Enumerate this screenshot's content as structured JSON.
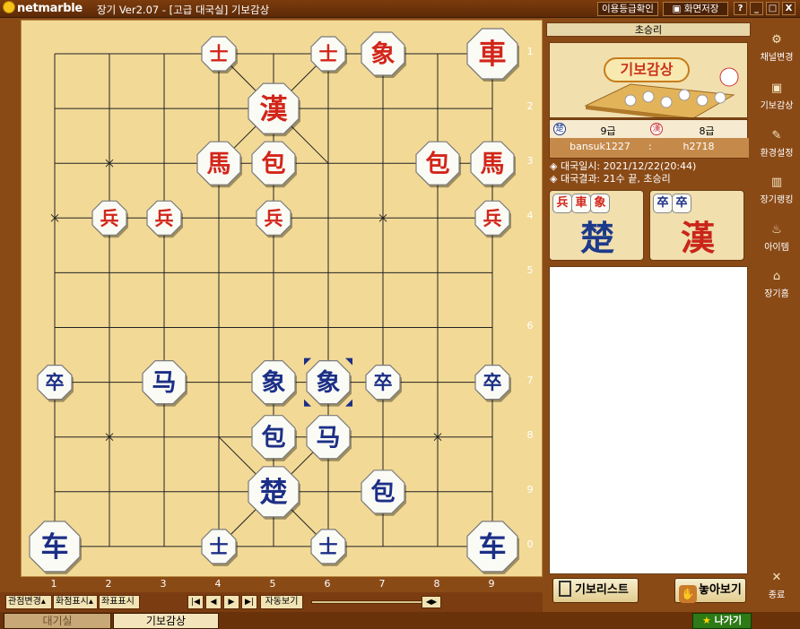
{
  "titlebar": {
    "logo": "netmarble",
    "title": "장기 Ver2.07 - [고급 대국실] 기보감상",
    "rating_button": "이용등급확인",
    "screenshot_button": "화면저장",
    "help_button": "?",
    "minimize_button": "_",
    "maximize_button": "□",
    "close_button": "X"
  },
  "board": {
    "column_labels": [
      "1",
      "2",
      "3",
      "4",
      "5",
      "6",
      "7",
      "8",
      "9"
    ],
    "row_labels": [
      "1",
      "2",
      "3",
      "4",
      "5",
      "6",
      "7",
      "8",
      "9",
      "0"
    ],
    "pieces": [
      {
        "side": "red",
        "char": "士",
        "col": 4,
        "row": 1,
        "size": "s"
      },
      {
        "side": "red",
        "char": "士",
        "col": 6,
        "row": 1,
        "size": "s"
      },
      {
        "side": "red",
        "char": "象",
        "col": 7,
        "row": 1,
        "size": "m"
      },
      {
        "side": "red",
        "char": "車",
        "col": 9,
        "row": 1,
        "size": "l"
      },
      {
        "side": "red",
        "char": "漢",
        "col": 5,
        "row": 2,
        "size": "l"
      },
      {
        "side": "red",
        "char": "馬",
        "col": 4,
        "row": 3,
        "size": "m"
      },
      {
        "side": "red",
        "char": "包",
        "col": 5,
        "row": 3,
        "size": "m"
      },
      {
        "side": "red",
        "char": "包",
        "col": 8,
        "row": 3,
        "size": "m"
      },
      {
        "side": "red",
        "char": "馬",
        "col": 9,
        "row": 3,
        "size": "m"
      },
      {
        "side": "red",
        "char": "兵",
        "col": 2,
        "row": 4,
        "size": "s"
      },
      {
        "side": "red",
        "char": "兵",
        "col": 3,
        "row": 4,
        "size": "s"
      },
      {
        "side": "red",
        "char": "兵",
        "col": 5,
        "row": 4,
        "size": "s"
      },
      {
        "side": "red",
        "char": "兵",
        "col": 9,
        "row": 4,
        "size": "s"
      },
      {
        "side": "blue",
        "char": "卒",
        "col": 1,
        "row": 7,
        "size": "s"
      },
      {
        "side": "blue",
        "char": "马",
        "col": 3,
        "row": 7,
        "size": "m"
      },
      {
        "side": "blue",
        "char": "象",
        "col": 5,
        "row": 7,
        "size": "m"
      },
      {
        "side": "blue",
        "char": "象",
        "col": 6,
        "row": 7,
        "size": "m"
      },
      {
        "side": "blue",
        "char": "卒",
        "col": 7,
        "row": 7,
        "size": "s"
      },
      {
        "side": "blue",
        "char": "卒",
        "col": 9,
        "row": 7,
        "size": "s"
      },
      {
        "side": "blue",
        "char": "包",
        "col": 5,
        "row": 8,
        "size": "m"
      },
      {
        "side": "blue",
        "char": "马",
        "col": 6,
        "row": 8,
        "size": "m"
      },
      {
        "side": "blue",
        "char": "楚",
        "col": 5,
        "row": 9,
        "size": "l"
      },
      {
        "side": "blue",
        "char": "包",
        "col": 7,
        "row": 9,
        "size": "m"
      },
      {
        "side": "blue",
        "char": "车",
        "col": 1,
        "row": 10,
        "size": "l"
      },
      {
        "side": "blue",
        "char": "士",
        "col": 4,
        "row": 10,
        "size": "s"
      },
      {
        "side": "blue",
        "char": "士",
        "col": 6,
        "row": 10,
        "size": "s"
      },
      {
        "side": "blue",
        "char": "车",
        "col": 9,
        "row": 10,
        "size": "l"
      }
    ],
    "selected": {
      "col": 6,
      "row": 7
    }
  },
  "controls": {
    "view_change": "관점변경",
    "point_display": "화점표시",
    "coord_display": "좌표표시",
    "first": "|◀",
    "prev": "◀",
    "next": "▶",
    "last": "▶|",
    "autoplay": "자동보기"
  },
  "tabs": {
    "waiting_room": "대기실",
    "record_view": "기보감상",
    "exit": "나가기"
  },
  "panel": {
    "result_header": "초승리",
    "thumbnail_title": "기보감상",
    "player1": {
      "badge": "楚",
      "rank": "9급",
      "name": "bansuk1227"
    },
    "player2": {
      "badge": "漢",
      "rank": "8급",
      "name": "h2718"
    },
    "game_date": "◈ 대국일시: 2021/12/22(20:44)",
    "game_result": "◈ 대국결과: 21수 끝, 초승리",
    "captured_by_cho": {
      "pieces": [
        "兵",
        "車",
        "象"
      ],
      "general": "楚"
    },
    "captured_by_han": {
      "pieces": [
        "卒",
        "卒"
      ],
      "general": "漢"
    },
    "record_list_button": "기보리스트",
    "place_button": "놓아보기"
  },
  "sidebar": [
    {
      "label": "채널변경",
      "icon": "channel-icon"
    },
    {
      "label": "기보감상",
      "icon": "record-icon"
    },
    {
      "label": "환경설정",
      "icon": "settings-icon"
    },
    {
      "label": "장기랭킹",
      "icon": "ranking-icon"
    },
    {
      "label": "아이템",
      "icon": "item-icon"
    },
    {
      "label": "장기홈",
      "icon": "home-icon"
    },
    {
      "label": "종료",
      "icon": "close-icon"
    }
  ]
}
